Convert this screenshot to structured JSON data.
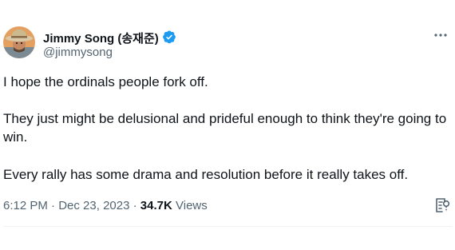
{
  "author": {
    "display_name": "Jimmy Song (송재준)",
    "handle": "@jimmysong",
    "verified": true,
    "avatar_icon": "avatar-cowboy-hat"
  },
  "tweet": {
    "paragraphs": [
      "I hope the ordinals people fork off.",
      "They just might be delusional and prideful enough to think they're going to win.",
      "Every rally has some drama and resolution before it really takes off."
    ],
    "time": "6:12 PM",
    "separator": "·",
    "date": "Dec 23, 2023",
    "views_count": "34.7K",
    "views_label": "Views"
  },
  "colors": {
    "verified_blue": "#1d9bf0",
    "text_primary": "#0f1419",
    "text_secondary": "#536471",
    "avatar_bg": "#e3a061"
  }
}
